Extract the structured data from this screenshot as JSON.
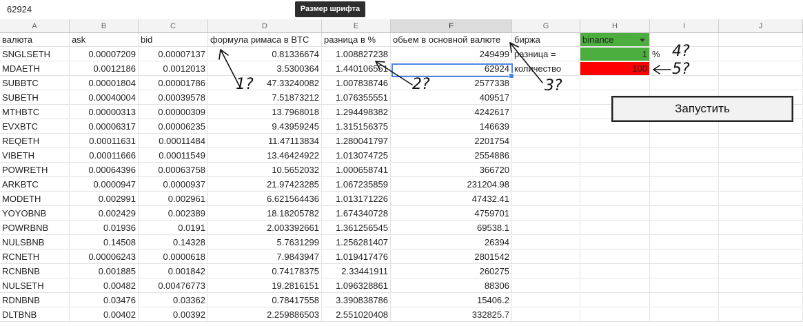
{
  "formula_bar": {
    "value": "62924"
  },
  "tooltip": {
    "text": "Размер шрифта"
  },
  "columns": [
    "A",
    "B",
    "C",
    "D",
    "E",
    "F",
    "G",
    "H",
    "I",
    "J"
  ],
  "header_row": {
    "A": "валюта",
    "B": "ask",
    "C": "bid",
    "D": "формула римаса в BTC",
    "E": "разница в %",
    "F": "обьем в основной валюте",
    "G": "биржа",
    "H": "binance"
  },
  "side": {
    "g2": "разница =",
    "h2": "1",
    "i2": "%",
    "g3": "количество",
    "h3": "100"
  },
  "rows": [
    [
      "SNGLSETH",
      "0.00007209",
      "0.00007137",
      "0.81336674",
      "1.008827238",
      "249499"
    ],
    [
      "MDAETH",
      "0.0012186",
      "0.0012013",
      "3.5300364",
      "1.440106551",
      "62924"
    ],
    [
      "SUBBTC",
      "0.00001804",
      "0.00001786",
      "47.33240082",
      "1.007838746",
      "2577338"
    ],
    [
      "SUBETH",
      "0.00040004",
      "0.00039578",
      "7.51873212",
      "1.076355551",
      "409517"
    ],
    [
      "MTHBTC",
      "0.00000313",
      "0.00000309",
      "13.7968018",
      "1.294498382",
      "4242617"
    ],
    [
      "EVXBTC",
      "0.00006317",
      "0.00006235",
      "9.43959245",
      "1.315156375",
      "146639"
    ],
    [
      "REQETH",
      "0.00011631",
      "0.00011484",
      "11.47113834",
      "1.280041797",
      "2201754"
    ],
    [
      "VIBETH",
      "0.00011666",
      "0.00011549",
      "13.46424922",
      "1.013074725",
      "2554886"
    ],
    [
      "POWRETH",
      "0.00064396",
      "0.00063758",
      "10.5652032",
      "1.000658741",
      "366720"
    ],
    [
      "ARKBTC",
      "0.0000947",
      "0.0000937",
      "21.97423285",
      "1.067235859",
      "231204.98"
    ],
    [
      "MODETH",
      "0.002991",
      "0.002961",
      "6.621564436",
      "1.013171226",
      "47432.41"
    ],
    [
      "YOYOBNB",
      "0.002429",
      "0.002389",
      "18.18205782",
      "1.674340728",
      "4759701"
    ],
    [
      "POWRBNB",
      "0.01936",
      "0.0191",
      "2.003392661",
      "1.361256545",
      "69538.1"
    ],
    [
      "NULSBNB",
      "0.14508",
      "0.14328",
      "5.7631299",
      "1.256281407",
      "26394"
    ],
    [
      "RCNETH",
      "0.00006243",
      "0.0000618",
      "7.9843947",
      "1.019417476",
      "2801542"
    ],
    [
      "RCNBNB",
      "0.001885",
      "0.001842",
      "0.74178375",
      "2.33441911",
      "260275"
    ],
    [
      "NULSETH",
      "0.00482",
      "0.00476773",
      "19.2816151",
      "1.096328861",
      "88306"
    ],
    [
      "RDNBNB",
      "0.03476",
      "0.03362",
      "0.78417558",
      "3.390838786",
      "15406.2"
    ],
    [
      "DLTBNB",
      "0.00402",
      "0.00392",
      "2.259886503",
      "2.551020408",
      "332825.7"
    ]
  ],
  "run_button": {
    "label": "Запустить"
  },
  "annotations": {
    "a1": "1?",
    "a2": "2?",
    "a3": "3?",
    "a4": "4?",
    "a5": "5?"
  }
}
